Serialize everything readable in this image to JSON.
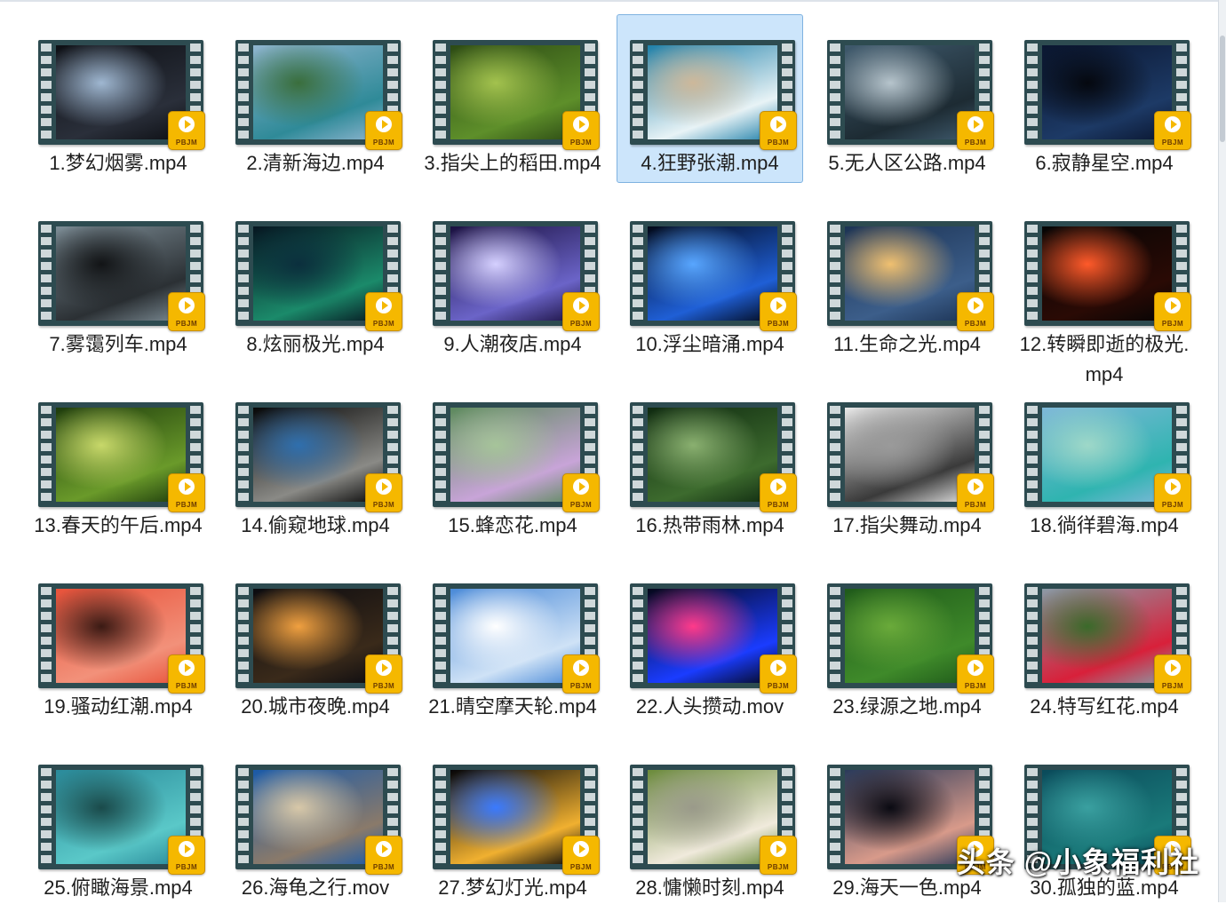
{
  "files": [
    {
      "name": "1.梦幻烟雾.mp4",
      "thumb": "smoke",
      "colors": [
        "#0d0f14",
        "#2a2f3a",
        "#9fb7d1"
      ],
      "selected": false
    },
    {
      "name": "2.清新海边.mp4",
      "thumb": "coast",
      "colors": [
        "#8fb5cf",
        "#2f8a98",
        "#3a6e3c"
      ],
      "selected": false
    },
    {
      "name": "3.指尖上的稻田.mp4",
      "thumb": "rice-field",
      "colors": [
        "#2c4a14",
        "#5e8f2a",
        "#a3c24e"
      ],
      "selected": false
    },
    {
      "name": "4.狂野张潮.mp4",
      "thumb": "waves",
      "colors": [
        "#1e7fa8",
        "#e8f3f6",
        "#cdb89a"
      ],
      "selected": true
    },
    {
      "name": "5.无人区公路.mp4",
      "thumb": "road",
      "colors": [
        "#3f5a6d",
        "#1d2b33",
        "#b6c4cc"
      ],
      "selected": false
    },
    {
      "name": "6.寂静星空.mp4",
      "thumb": "night-sky",
      "colors": [
        "#0a1630",
        "#1d3a66",
        "#05080f"
      ],
      "selected": false
    },
    {
      "name": "7.雾霭列车.mp4",
      "thumb": "foggy-road",
      "colors": [
        "#7d8d96",
        "#2b3034",
        "#121416"
      ],
      "selected": false
    },
    {
      "name": "8.炫丽极光.mp4",
      "thumb": "aurora",
      "colors": [
        "#061520",
        "#1b8a6a",
        "#0b2f3d"
      ],
      "selected": false
    },
    {
      "name": "9.人潮夜店.mp4",
      "thumb": "club",
      "colors": [
        "#1a1040",
        "#6b64c8",
        "#d5d0ff"
      ],
      "selected": false
    },
    {
      "name": "10.浮尘暗涌.mp4",
      "thumb": "blue-mesh",
      "colors": [
        "#020818",
        "#1f5fd6",
        "#58a6ff"
      ],
      "selected": false
    },
    {
      "name": "11.生命之光.mp4",
      "thumb": "city-lights",
      "colors": [
        "#1c3354",
        "#3c5e8a",
        "#f0c070"
      ],
      "selected": false
    },
    {
      "name": "12.转瞬即逝的极光.mp4",
      "thumb": "atom",
      "colors": [
        "#050505",
        "#2a0a05",
        "#ff5a2a"
      ],
      "selected": false
    },
    {
      "name": "13.春天的午后.mp4",
      "thumb": "garden",
      "colors": [
        "#1d3b0c",
        "#6a9a2a",
        "#c8d86a"
      ],
      "selected": false
    },
    {
      "name": "14.偷窥地球.mp4",
      "thumb": "earth",
      "colors": [
        "#060606",
        "#8a8a86",
        "#2f6fae"
      ],
      "selected": false
    },
    {
      "name": "15.蜂恋花.mp4",
      "thumb": "flower",
      "colors": [
        "#5c8a5c",
        "#c8a4d8",
        "#a6c49a"
      ],
      "selected": false
    },
    {
      "name": "16.热带雨林.mp4",
      "thumb": "forest",
      "colors": [
        "#0f2a10",
        "#3d6b2e",
        "#8ab070"
      ],
      "selected": false
    },
    {
      "name": "17.指尖舞动.mp4",
      "thumb": "typing",
      "colors": [
        "#e8e8e8",
        "#3a3a3a",
        "#9a9a9a"
      ],
      "selected": false
    },
    {
      "name": "18.徜徉碧海.mp4",
      "thumb": "sea",
      "colors": [
        "#7fb8d8",
        "#2fb4b0",
        "#9ed8c8"
      ],
      "selected": false
    },
    {
      "name": "19.骚动红潮.mp4",
      "thumb": "red-abstract",
      "colors": [
        "#e8523a",
        "#f2917a",
        "#3a1a14"
      ],
      "selected": false
    },
    {
      "name": "20.城市夜晚.mp4",
      "thumb": "night-city",
      "colors": [
        "#0b0b10",
        "#3a2a1a",
        "#f0a040"
      ],
      "selected": false
    },
    {
      "name": "21.晴空摩天轮.mp4",
      "thumb": "ferris",
      "colors": [
        "#4a8ad8",
        "#cfe2f6",
        "#ffffff"
      ],
      "selected": false
    },
    {
      "name": "22.人头攒动.mov",
      "thumb": "concert",
      "colors": [
        "#05071a",
        "#1a3cff",
        "#ff3a8a"
      ],
      "selected": false
    },
    {
      "name": "23.绿源之地.mp4",
      "thumb": "green",
      "colors": [
        "#1f5a1a",
        "#3f8a2a",
        "#6aaa3a"
      ],
      "selected": false
    },
    {
      "name": "24.特写红花.mp4",
      "thumb": "red-flower",
      "colors": [
        "#8a9aa6",
        "#d8203a",
        "#3a6a2a"
      ],
      "selected": false
    },
    {
      "name": "25.俯瞰海景.mp4",
      "thumb": "aerial-sea",
      "colors": [
        "#2a8a9a",
        "#5ac8c8",
        "#1a4a4a"
      ],
      "selected": false
    },
    {
      "name": "26.海龟之行.mov",
      "thumb": "turtle",
      "colors": [
        "#1a5aa8",
        "#8a7a6a",
        "#d8c8a8"
      ],
      "selected": false
    },
    {
      "name": "27.梦幻灯光.mp4",
      "thumb": "bokeh",
      "colors": [
        "#050508",
        "#f0b030",
        "#3a7aff"
      ],
      "selected": false
    },
    {
      "name": "28.慵懒时刻.mp4",
      "thumb": "dog",
      "colors": [
        "#6a8a3a",
        "#f0eadc",
        "#9a9a8a"
      ],
      "selected": false
    },
    {
      "name": "29.海天一色.mp4",
      "thumb": "sunset",
      "colors": [
        "#2a3a5a",
        "#d89a8a",
        "#0a0a12"
      ],
      "selected": false
    },
    {
      "name": "30.孤独的蓝.mp4",
      "thumb": "deep-blue",
      "colors": [
        "#0a4a5a",
        "#1a7a7a",
        "#3aa0a0"
      ],
      "selected": false
    }
  ],
  "badge": {
    "brand": "PBJM",
    "color": "#f5b800"
  },
  "watermark": "头条 @小象福利社"
}
